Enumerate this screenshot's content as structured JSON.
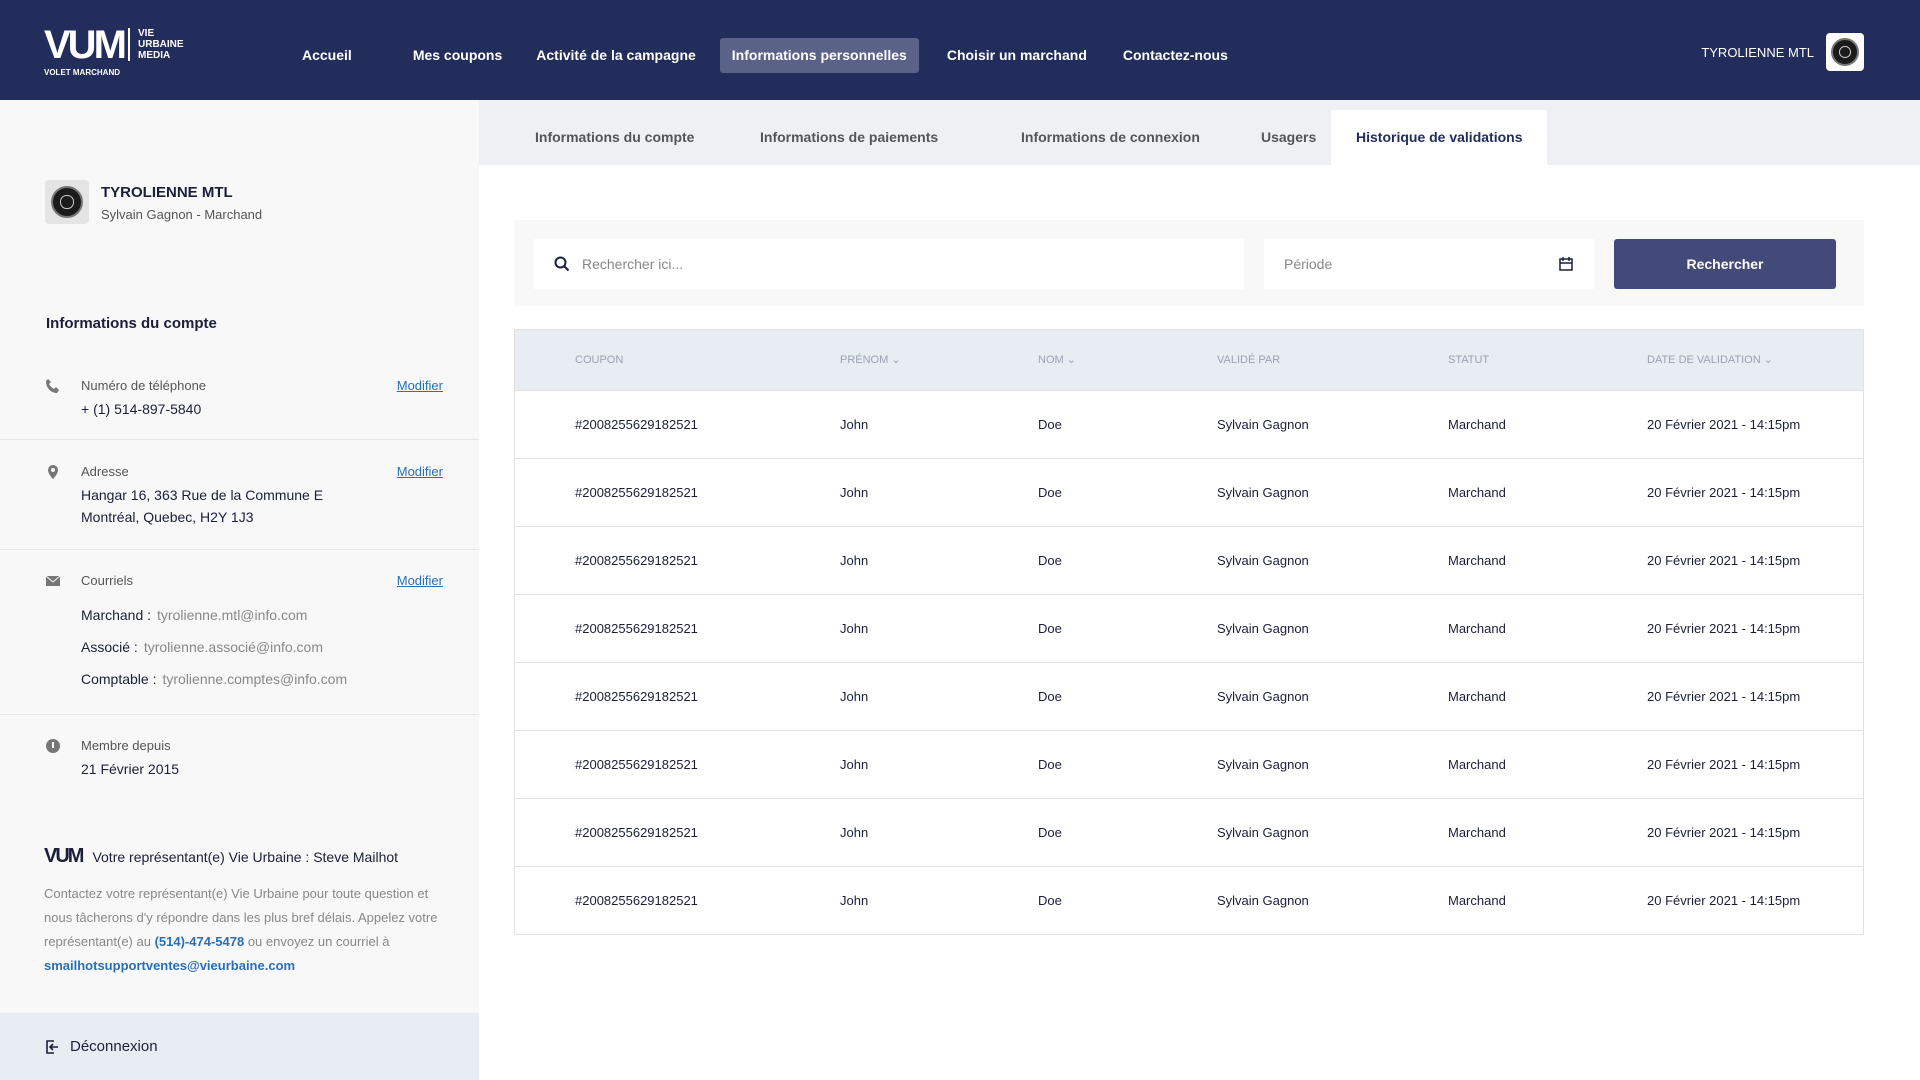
{
  "brand": {
    "mark": "VUM",
    "lines": [
      "VIE",
      "URBAINE",
      "MEDIA"
    ],
    "sub": "VOLET MARCHAND"
  },
  "nav": [
    "Accueil",
    "Mes coupons",
    "Activité de la campagne",
    "Informations personnelles",
    "Choisir un marchand",
    "Contactez-nous"
  ],
  "user": {
    "name": "TYROLIENNE MTL"
  },
  "profile": {
    "name": "TYROLIENNE MTL",
    "role": "Sylvain Gagnon - Marchand"
  },
  "account": {
    "title": "Informations du compte",
    "phone_label": "Numéro de téléphone",
    "phone": "+ (1) 514-897-5840",
    "address_label": "Adresse",
    "address1": "Hangar 16, 363 Rue de la Commune E",
    "address2": "Montréal, Quebec, H2Y 1J3",
    "emails_label": "Courriels",
    "emails": [
      {
        "k": "Marchand :",
        "v": "tyrolienne.mtl@info.com"
      },
      {
        "k": "Associé :",
        "v": "tyrolienne.associé@info.com"
      },
      {
        "k": "Comptable :",
        "v": "tyrolienne.comptes@info.com"
      }
    ],
    "member_label": "Membre depuis",
    "member": "21 Février 2015",
    "modify": "Modifier"
  },
  "rep": {
    "title": "Votre représentant(e) Vie Urbaine : Steve Mailhot",
    "text": "Contactez votre représentant(e) Vie Urbaine pour toute question et nous tâcherons d'y répondre dans les plus bref délais. Appelez votre représentant(e) au ",
    "phone": "(514)-474-5478",
    "mid": " ou envoyez un courriel à ",
    "email": "smailhotsupportventes@vieurbaine.com"
  },
  "logout": "Déconnexion",
  "tabs": [
    "Informations du compte",
    "Informations de paiements",
    "Informations de connexion",
    "Usagers",
    "Historique de validations"
  ],
  "search": {
    "placeholder": "Rechercher ici...",
    "period": "Période",
    "button": "Rechercher"
  },
  "table": {
    "headers": [
      "COUPON",
      "PRÉNOM",
      "NOM",
      "VALIDÉ PAR",
      "STATUT",
      "DATE DE VALIDATION"
    ],
    "rows": [
      [
        "#2008255629182521",
        "John",
        "Doe",
        "Sylvain Gagnon",
        "Marchand",
        "20 Février 2021 - 14:15pm"
      ],
      [
        "#2008255629182521",
        "John",
        "Doe",
        "Sylvain Gagnon",
        "Marchand",
        "20 Février 2021 - 14:15pm"
      ],
      [
        "#2008255629182521",
        "John",
        "Doe",
        "Sylvain Gagnon",
        "Marchand",
        "20 Février 2021 - 14:15pm"
      ],
      [
        "#2008255629182521",
        "John",
        "Doe",
        "Sylvain Gagnon",
        "Marchand",
        "20 Février 2021 - 14:15pm"
      ],
      [
        "#2008255629182521",
        "John",
        "Doe",
        "Sylvain Gagnon",
        "Marchand",
        "20 Février 2021 - 14:15pm"
      ],
      [
        "#2008255629182521",
        "John",
        "Doe",
        "Sylvain Gagnon",
        "Marchand",
        "20 Février 2021 - 14:15pm"
      ],
      [
        "#2008255629182521",
        "John",
        "Doe",
        "Sylvain Gagnon",
        "Marchand",
        "20 Février 2021 - 14:15pm"
      ],
      [
        "#2008255629182521",
        "John",
        "Doe",
        "Sylvain Gagnon",
        "Marchand",
        "20 Février 2021 - 14:15pm"
      ]
    ]
  }
}
